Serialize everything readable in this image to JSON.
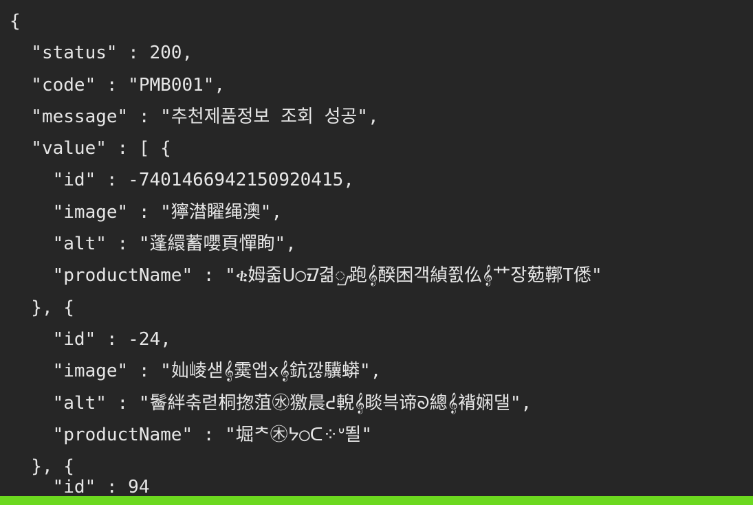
{
  "editor": {
    "lines": [
      "{",
      "  \"status\" : 200,",
      "  \"code\" : \"PMB001\",",
      "  \"message\" : \"추천제품정보 조회 성공\",",
      "  \"value\" : [ {",
      "    \"id\" : -7401466942150920415,",
      "    \"image\" : \"獰澘矅绳澳\",",
      "    \"alt\" : \"蓬繯蓄嚶頁憚眴\",",
      "    \"productName\" : \"ቂ姆줇ᑌ○ᮙ겲ᮡ跑𝄞䤆困객緽쬜仫𝄞艹장葂鞹T僁\"",
      "  }, {",
      "    \"id\" : -24,",
      "    \"image\" : \"奾崚샏𝄞霙앱x𝄞鈧깒驥蟒\",",
      "    \"alt\" : \"鬠絆춖렫桐揔菹㊌獥晨ᕍ輗𝄞睒븍谛ᘐ總𝄞褙娴댈\",",
      "    \"productName\" : \"堀ᄎ㊍ᔭ○ᑕ⁘ᐡ뙬\"",
      "  }, {",
      "    \"id\" : 94"
    ]
  },
  "colors": {
    "background": "#262626",
    "text": "#e6e6e6",
    "status_bar": "#6cd81f"
  }
}
